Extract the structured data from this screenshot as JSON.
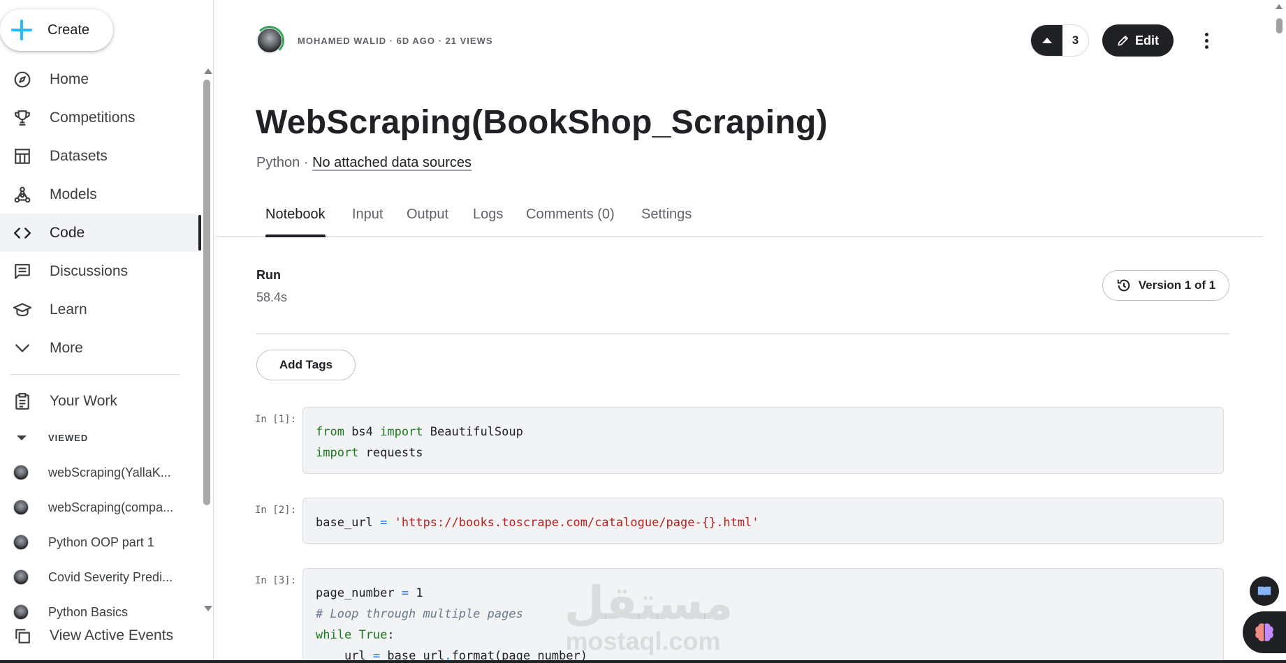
{
  "sidebar": {
    "create_label": "Create",
    "nav": [
      {
        "label": "Home",
        "icon": "compass-icon"
      },
      {
        "label": "Competitions",
        "icon": "trophy-icon"
      },
      {
        "label": "Datasets",
        "icon": "table-icon"
      },
      {
        "label": "Models",
        "icon": "models-icon"
      },
      {
        "label": "Code",
        "icon": "code-icon",
        "active": true
      },
      {
        "label": "Discussions",
        "icon": "comment-icon"
      },
      {
        "label": "Learn",
        "icon": "school-icon"
      },
      {
        "label": "More",
        "icon": "chevron-down-icon"
      }
    ],
    "your_work_label": "Your Work",
    "viewed_label": "VIEWED",
    "viewed_items": [
      "webScraping(YallaK...",
      "webScraping(compa...",
      "Python OOP part 1",
      "Covid Severity Predi...",
      "Python Basics"
    ],
    "active_events_label": "View Active Events"
  },
  "header": {
    "meta": "MOHAMED WALID · 6D AGO · 21 VIEWS",
    "vote_count": "3",
    "edit_label": "Edit"
  },
  "notebook": {
    "title": "WebScraping(BookShop_Scraping)",
    "language": "Python",
    "separator": "·",
    "data_sources_link": "No attached data sources"
  },
  "tabs": [
    "Notebook",
    "Input",
    "Output",
    "Logs",
    "Comments (0)",
    "Settings"
  ],
  "run": {
    "label": "Run",
    "time": "58.4s",
    "version_label": "Version 1 of 1"
  },
  "add_tags_label": "Add Tags",
  "cells": [
    {
      "prompt": "In [1]:"
    },
    {
      "prompt": "In [2]:"
    },
    {
      "prompt": "In [3]:"
    }
  ],
  "code": {
    "c1_l1_kw": "from",
    "c1_l1_a": " bs4 ",
    "c1_l1_kw2": "import",
    "c1_l1_b": " BeautifulSoup",
    "c1_l2_kw": "import",
    "c1_l2_a": " requests",
    "c2_a": "base_url ",
    "c2_op": "=",
    "c2_str": "'https://books.toscrape.com/catalogue/page-{}.html'",
    "c3_l1_a": "page_number ",
    "c3_l1_op": "=",
    "c3_l1_b": " 1",
    "c3_l2_cm": "# Loop through multiple pages",
    "c3_l3_kw": "while",
    "c3_l3_b": "True",
    "c3_l3_c": ":",
    "c3_l4_a": "    url ",
    "c3_l4_op": "=",
    "c3_l4_b": " base_url",
    "c3_l4_op2": ".",
    "c3_l4_c": "format(page_number)"
  },
  "watermark": {
    "arabic": "مستقل",
    "latin": "mostaql.com"
  },
  "colors": {
    "accent": "#20beff",
    "dark": "#202124",
    "string": "#ba2121",
    "keyword": "#1e7a1e"
  }
}
